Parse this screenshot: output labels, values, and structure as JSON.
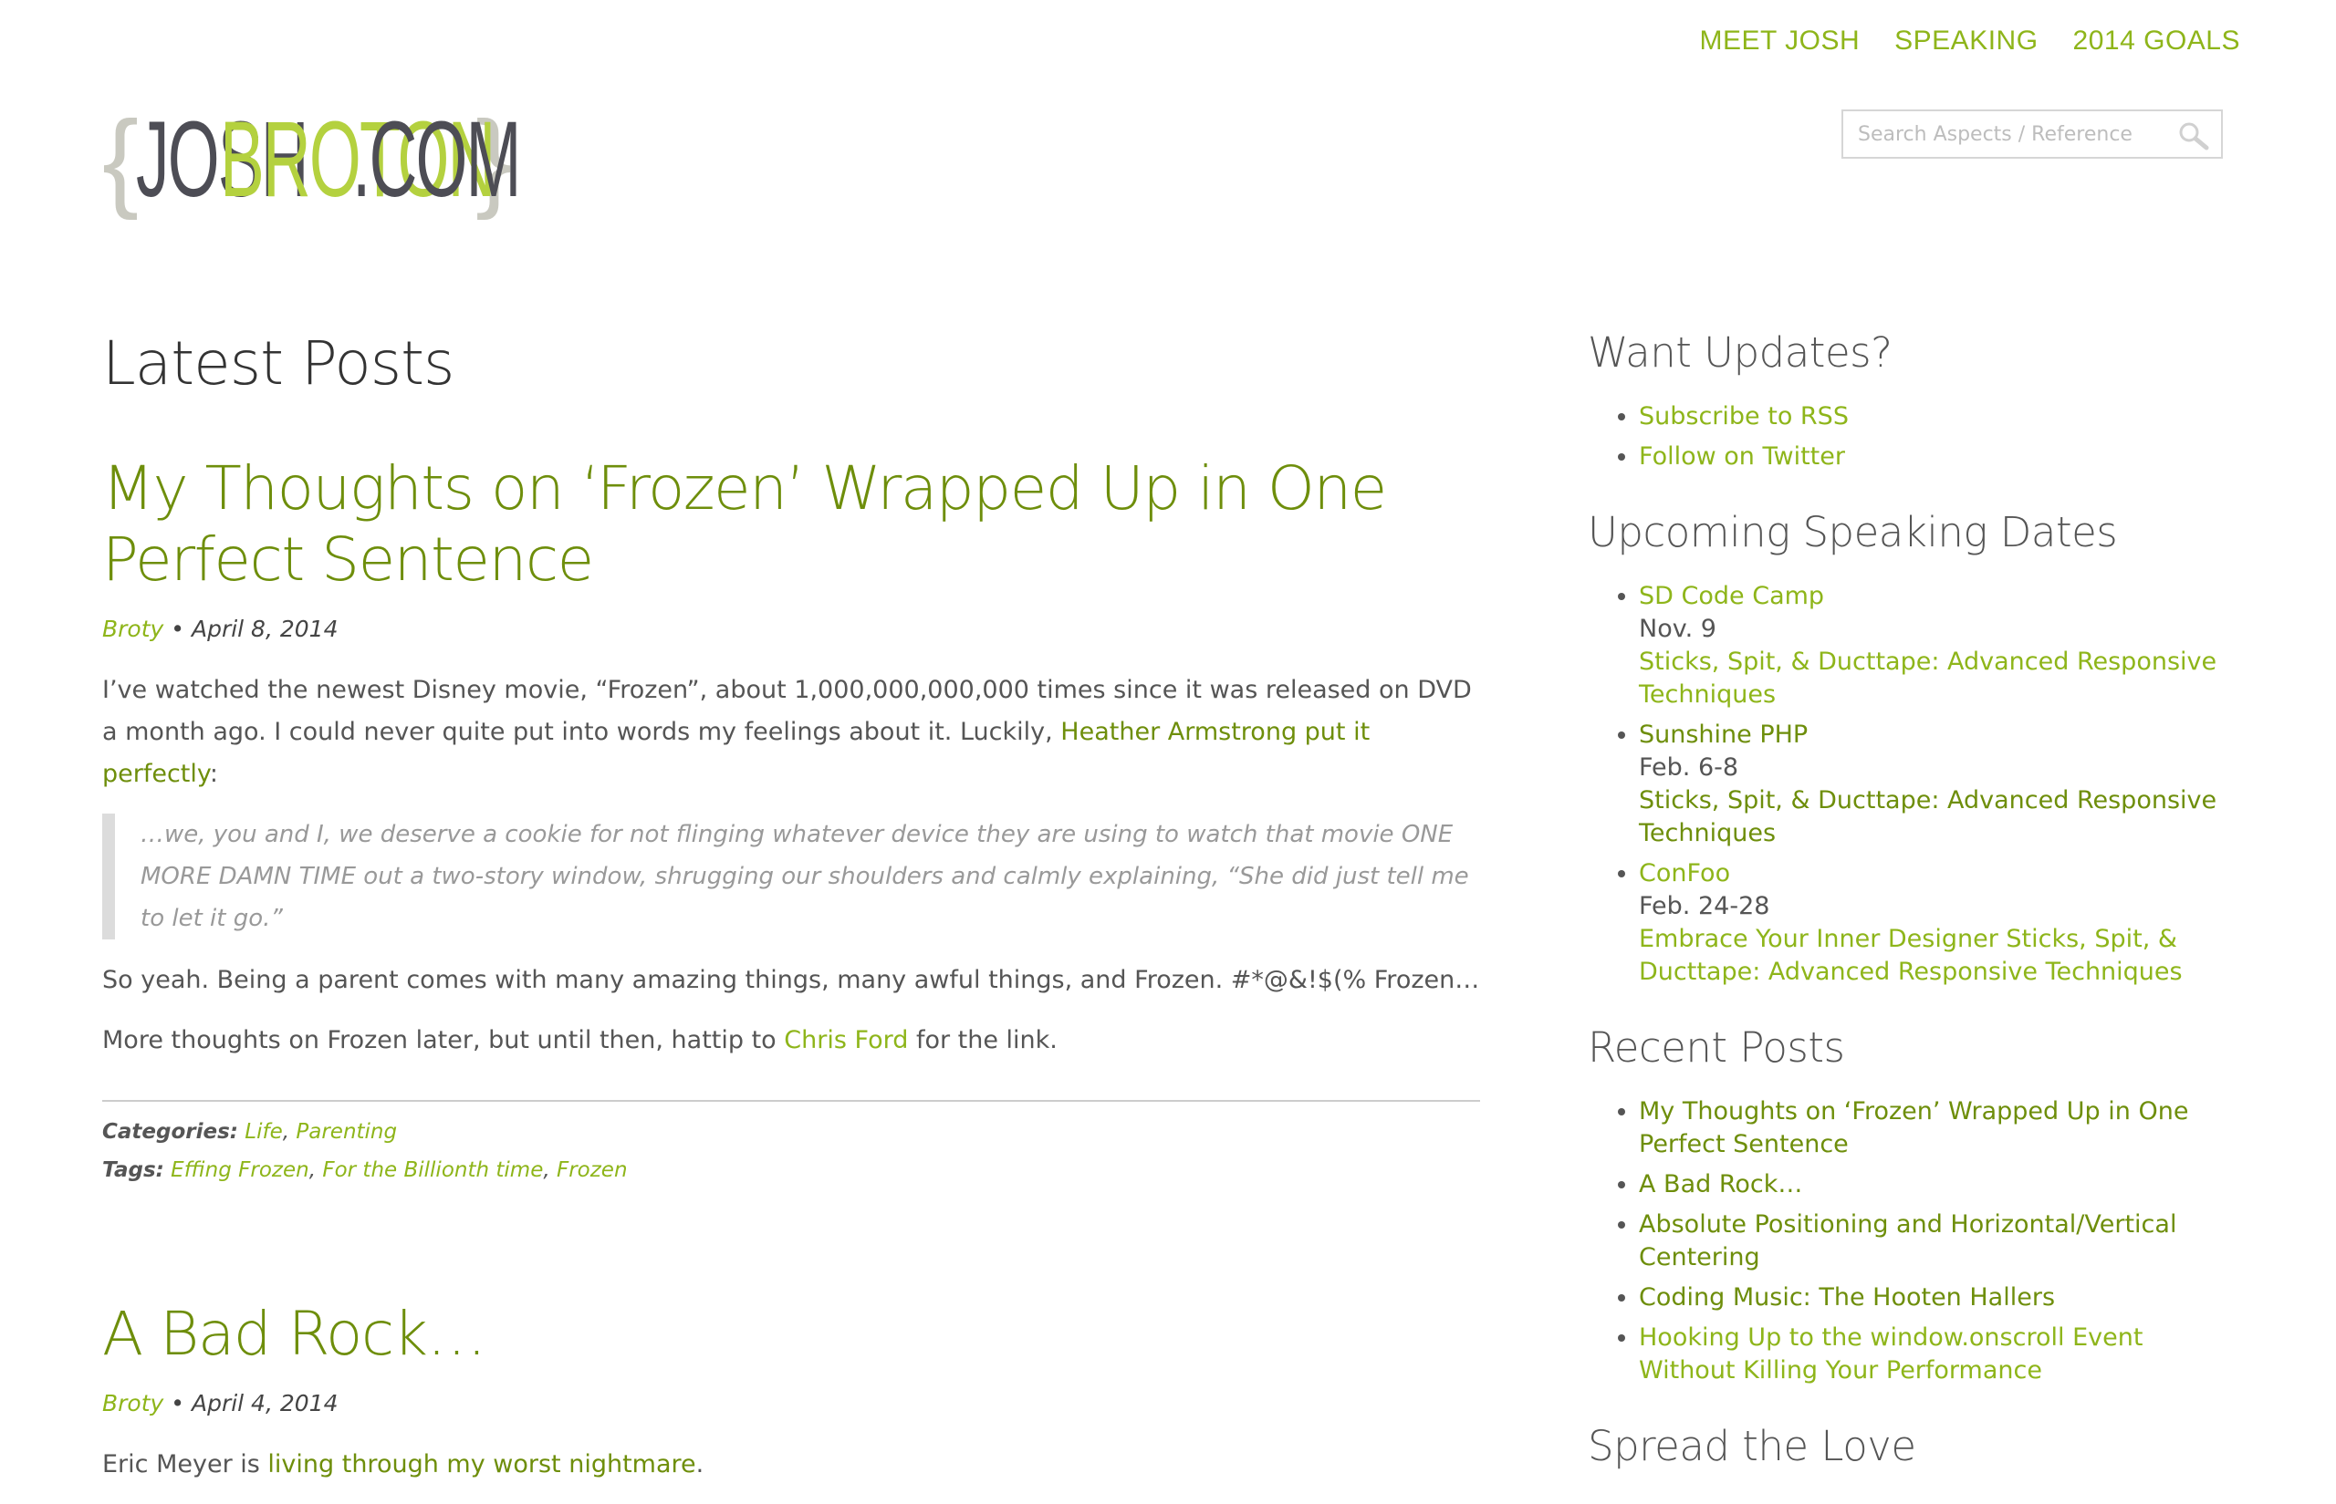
{
  "nav": {
    "items": [
      {
        "label": "MEET JOSH"
      },
      {
        "label": "SPEAKING"
      },
      {
        "label": "2014 GOALS"
      }
    ]
  },
  "logo": {
    "brace_open": "{",
    "part1": "JOSH",
    "part2": "BROTON",
    "part3": ".COM",
    "brace_close": "}"
  },
  "search": {
    "placeholder": "Search Aspects / Reference"
  },
  "main": {
    "heading": "Latest Posts",
    "post1": {
      "title": "My Thoughts on ‘Frozen’ Wrapped Up in One Perfect Sentence",
      "author": "Broty",
      "date": "• April 8, 2014",
      "p1_text": "I’ve watched the newest Disney movie, “Frozen”, about 1,000,000,000,000 times since it was released on DVD a month ago. I could never quite put into words my feelings about it. Luckily, ",
      "p1_link": "Heather Armstrong put it perfectly",
      "p1_end": ":",
      "quote": "…we, you and I, we deserve a cookie for not flinging whatever device they are using to watch that movie ONE MORE DAMN TIME out a two-story window, shrugging our shoulders and calmly explaining, “She did just tell me to let it go.”",
      "p2": "So yeah. Being a parent comes with many amazing things, many awful things, and Frozen. #*@&!$(% Frozen…",
      "p3_text": "More thoughts on Frozen later, but until then, hattip to ",
      "p3_link": "Chris Ford",
      "p3_end": " for the link.",
      "categories_label": "Categories:",
      "categories": [
        "Life",
        "Parenting"
      ],
      "tags_label": "Tags:",
      "tags": [
        "Effing Frozen",
        "For the Billionth time",
        "Frozen"
      ]
    },
    "post2": {
      "title": "A Bad Rock…",
      "author": "Broty",
      "date": "• April 4, 2014",
      "p1_text": "Eric Meyer is ",
      "p1_link": "living through my worst nightmare",
      "p1_end": "."
    }
  },
  "sidebar": {
    "updates": {
      "title": "Want Updates?",
      "items": [
        {
          "label": "Subscribe to RSS"
        },
        {
          "label": "Follow on Twitter"
        }
      ]
    },
    "speaking": {
      "title": "Upcoming Speaking Dates",
      "items": [
        {
          "event": "SD Code Camp",
          "date": "Nov. 9",
          "talk": "Sticks, Spit, & Ducttape: Advanced Responsive Techniques"
        },
        {
          "event": "Sunshine PHP",
          "date": "Feb. 6-8",
          "talk": "Sticks, Spit, & Ducttape: Advanced Responsive Techniques"
        },
        {
          "event": "ConFoo",
          "date": "Feb. 24-28",
          "talk": "Embrace Your Inner Designer Sticks, Spit, & Ducttape: Advanced Responsive Techniques"
        }
      ]
    },
    "recent": {
      "title": "Recent Posts",
      "items": [
        {
          "label": "My Thoughts on ‘Frozen’ Wrapped Up in One Perfect Sentence"
        },
        {
          "label": "A Bad Rock…"
        },
        {
          "label": "Absolute Positioning and Horizontal/Vertical Centering"
        },
        {
          "label": "Coding Music: The Hooten Hallers"
        },
        {
          "label": "Hooking Up to the window.onscroll Event Without Killing Your Performance"
        }
      ]
    },
    "spread": {
      "title": "Spread the Love"
    }
  },
  "colors": {
    "accent": "#8eb51a",
    "accent_dark": "#6e8e0b",
    "logo_green": "#b4d13f",
    "logo_dark": "#4d4d55"
  }
}
